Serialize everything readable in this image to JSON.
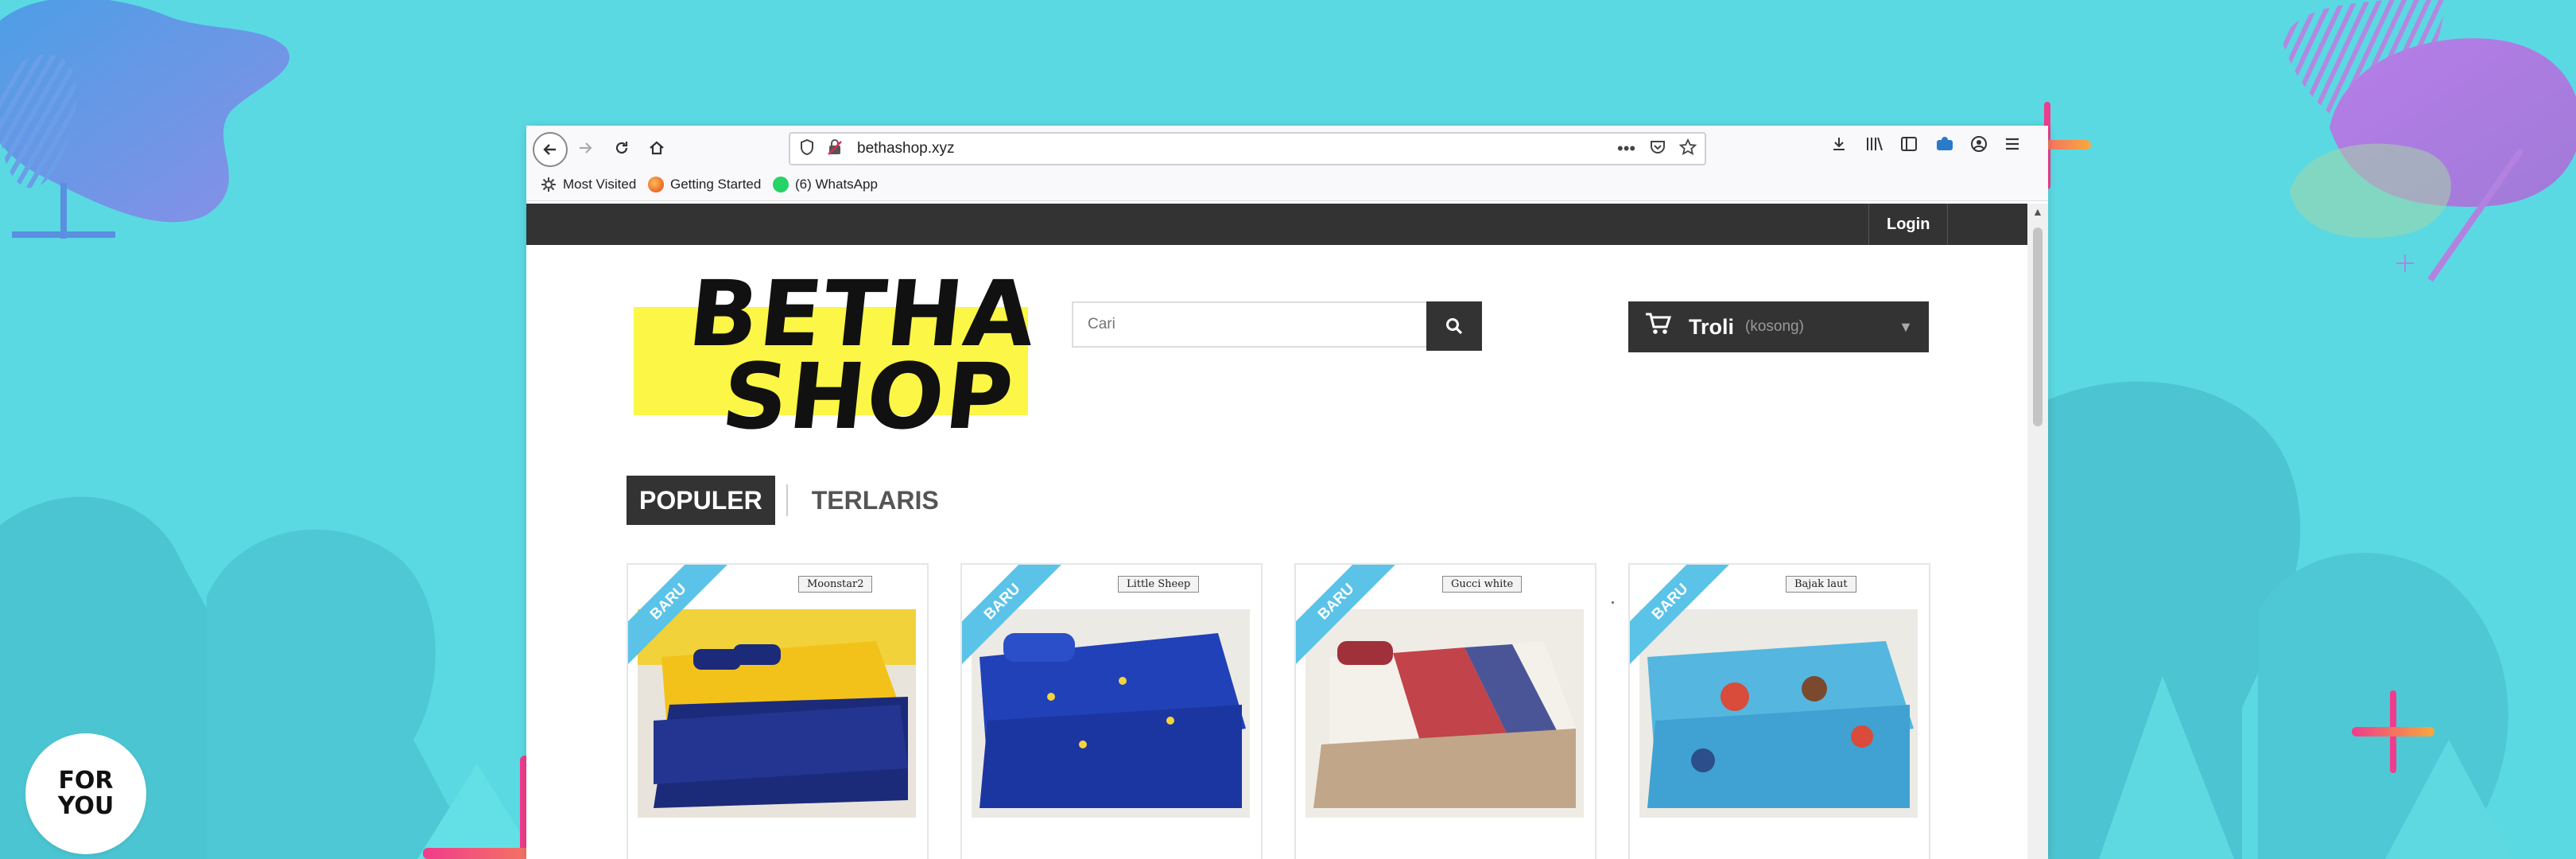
{
  "browser": {
    "url": "bethashop.xyz",
    "bookmarks": [
      {
        "label": "Most Visited"
      },
      {
        "label": "Getting Started"
      },
      {
        "label": "(6) WhatsApp"
      }
    ]
  },
  "site": {
    "login_label": "Login",
    "logo": {
      "line1": "BETHA",
      "line2": "SHOP"
    },
    "search": {
      "placeholder": "Cari"
    },
    "cart": {
      "label": "Troli",
      "status": "(kosong)"
    },
    "tabs": [
      {
        "label": "POPULER",
        "active": true
      },
      {
        "label": "TERLARIS",
        "active": false
      }
    ],
    "products": [
      {
        "badge": "BARU",
        "tag": "Moonstar2"
      },
      {
        "badge": "BARU",
        "tag": "Little Sheep"
      },
      {
        "badge": "BARU",
        "tag": "Gucci white"
      },
      {
        "badge": "BARU",
        "tag": "Bajak laut"
      }
    ]
  },
  "badge_logo": {
    "line1": "FOR",
    "line2": "YOU"
  },
  "colors": {
    "background": "#5ad9e3",
    "topbar": "#333333",
    "logo_band": "#fcf647",
    "ribbon": "#5bc3e8",
    "accent_pink": "#f03c8c",
    "accent_orange": "#f7a93b"
  }
}
